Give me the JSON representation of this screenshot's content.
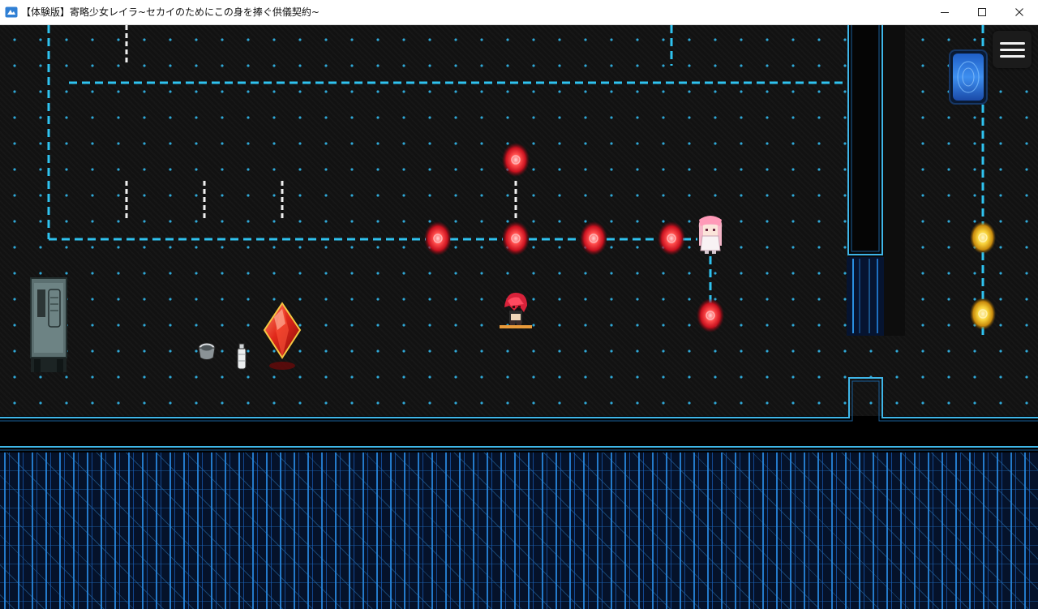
{
  "window": {
    "title": "【体験版】寄略少女レイラ~セカイのためにこの身を捧ぐ供儀契約~"
  },
  "controls": {
    "minimize_icon": "minimize-icon",
    "maximize_icon": "maximize-icon",
    "close_icon": "close-icon"
  },
  "hud": {
    "menu_icon": "hamburger-menu-icon"
  },
  "colors": {
    "neon_line": "#2fc3f0",
    "title_bar": "#ffffff",
    "floor": "#121212",
    "red_orb": "#e8283c",
    "gold_orb": "#f2b418",
    "crystal": "#d62a1c",
    "circuit": "#1d6fd0"
  },
  "entities": {
    "player": "red-haired-hero",
    "npc": "pink-haired-girl",
    "red_orb_count": 6,
    "gold_orb_count": 2
  }
}
